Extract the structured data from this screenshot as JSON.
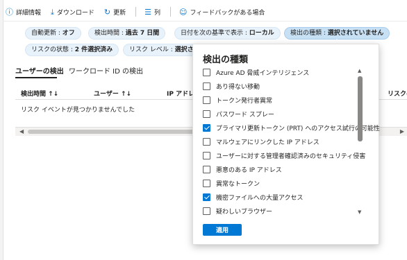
{
  "toolbar": {
    "details": "詳細情報",
    "download": "ダウンロード",
    "refresh": "更新",
    "columns": "列",
    "feedback": "フィードバックがある場合"
  },
  "filters": [
    {
      "key": "自動更新 : ",
      "value": "オフ"
    },
    {
      "key": "検出時間 : ",
      "value": "過去 7 日間"
    },
    {
      "key": "日付を次の基準で表示 : ",
      "value": "ローカル"
    },
    {
      "key": "検出の種類 : ",
      "value": "選択されていません"
    },
    {
      "key": "リスクの状態 : ",
      "value": "2 件選択済み"
    },
    {
      "key": "リスク レベル : ",
      "value": "選択されて"
    }
  ],
  "tabs": [
    "ユーザーの検出",
    "ワークロード ID の検出"
  ],
  "table": {
    "headers": [
      "検出時間 ↑↓",
      "ユーザー ↑↓",
      "IP アドレス",
      "リスクの"
    ],
    "empty_message": "リスク イベントが見つかりませんでした"
  },
  "dropdown": {
    "title": "検出の種類",
    "apply_label": "適用",
    "options": [
      {
        "label": "Azure AD 脅威インテリジェンス",
        "checked": false
      },
      {
        "label": "あり得ない移動",
        "checked": false
      },
      {
        "label": "トークン発行者異常",
        "checked": false
      },
      {
        "label": "パスワード スプレー",
        "checked": false
      },
      {
        "label": "プライマリ更新トークン (PRT) へのアクセス試行の可能性",
        "checked": true
      },
      {
        "label": "マルウェアにリンクした IP アドレス",
        "checked": false
      },
      {
        "label": "ユーザーに対する管理者確認済みのセキュリティ侵害",
        "checked": false
      },
      {
        "label": "悪意のある IP アドレス",
        "checked": false
      },
      {
        "label": "異常なトークン",
        "checked": false
      },
      {
        "label": "機密ファイルへの大量アクセス",
        "checked": true
      },
      {
        "label": "疑わしいブラウザー",
        "checked": false
      }
    ]
  },
  "colors": {
    "accent": "#0078d4",
    "pill_bg": "#e8f2fb"
  }
}
